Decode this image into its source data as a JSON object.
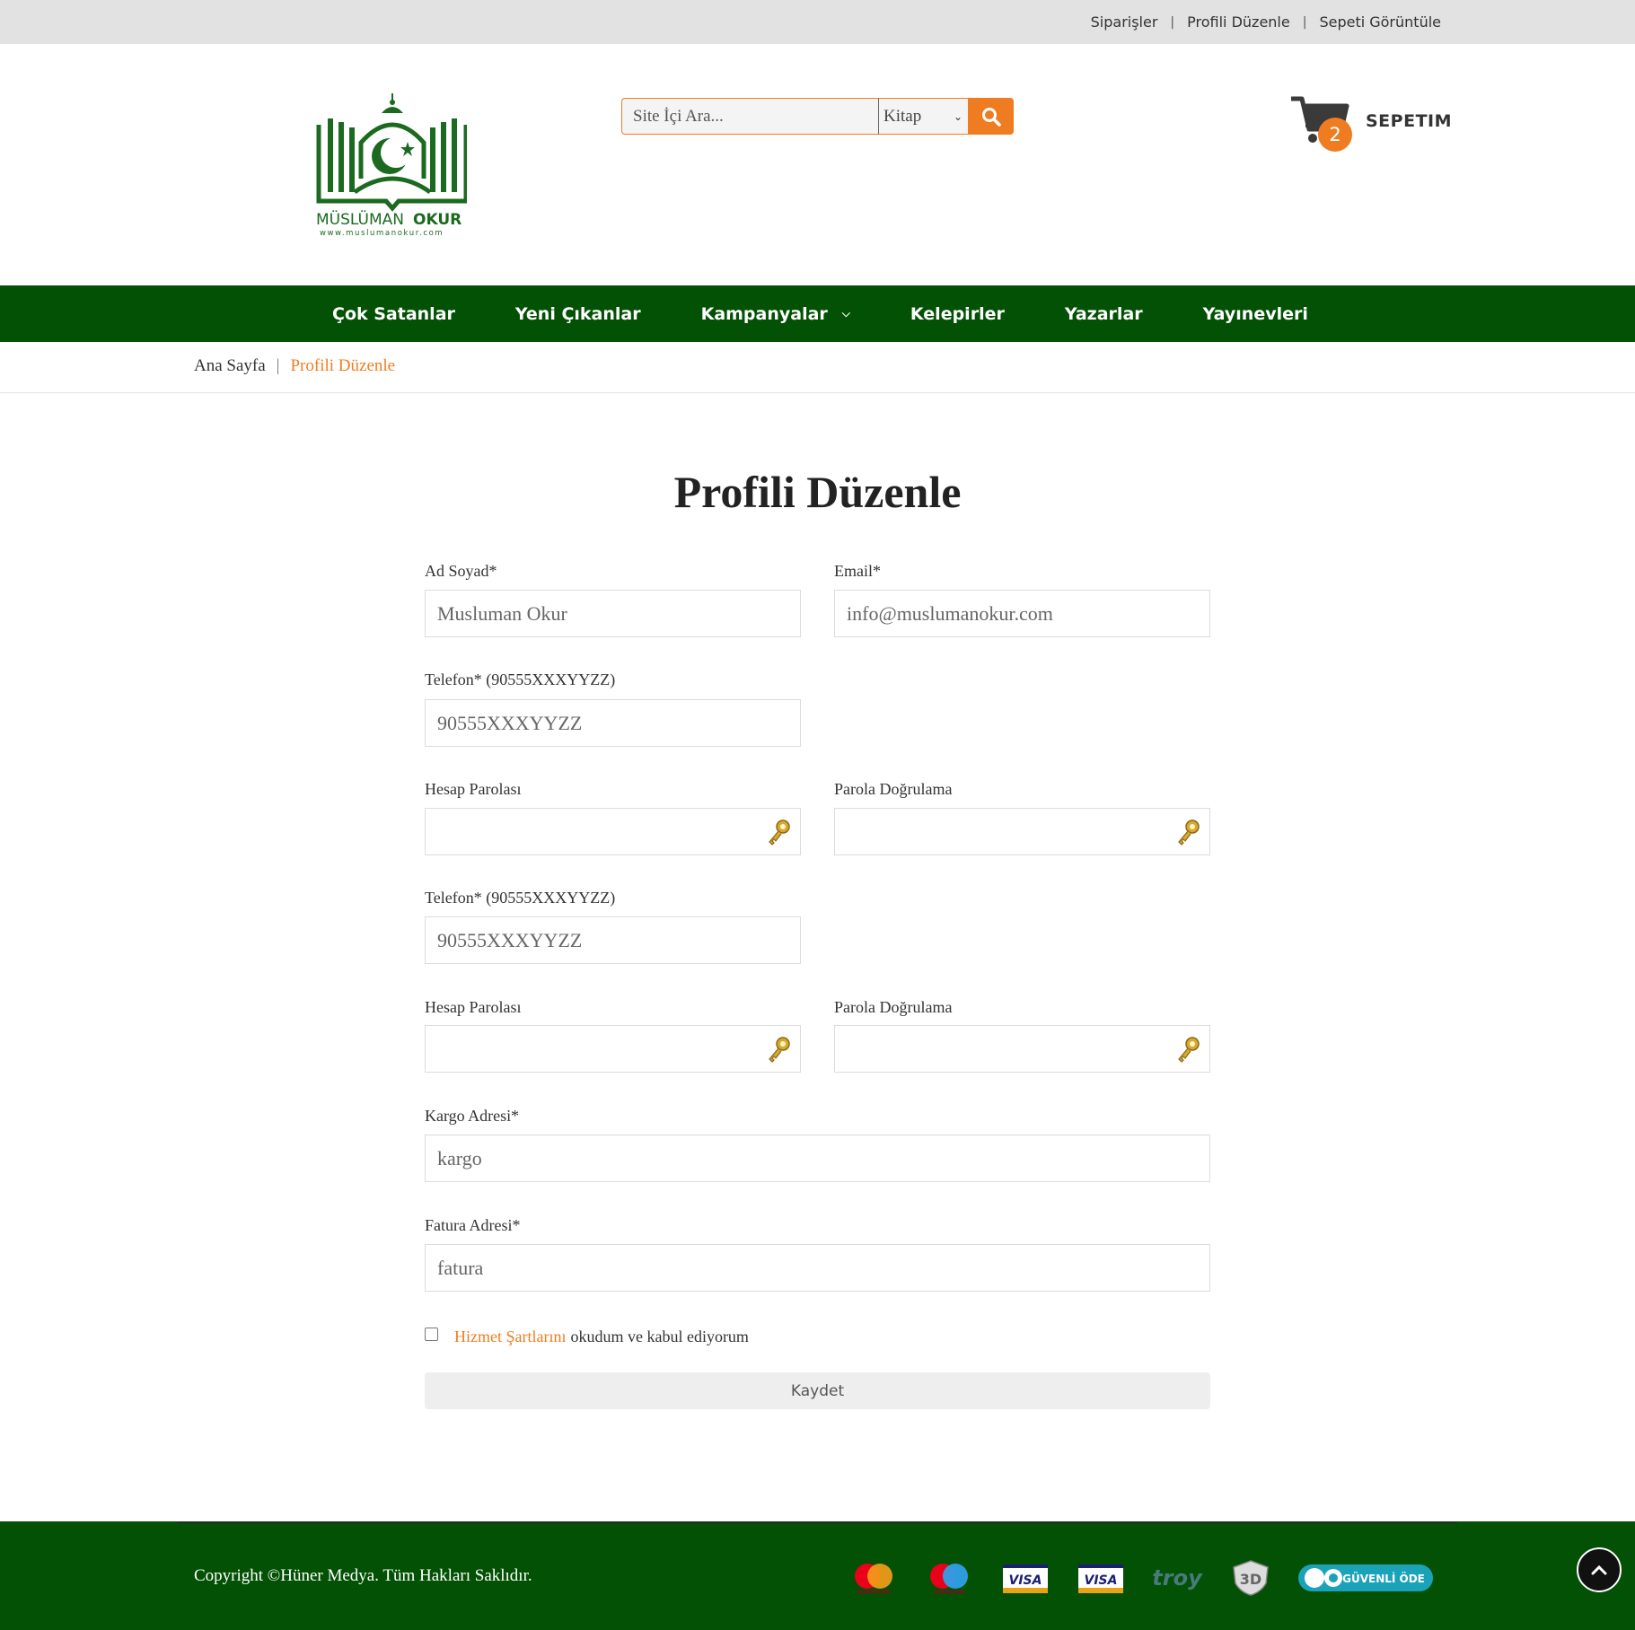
{
  "top_links": [
    "Siparişler",
    "Profili Düzenle",
    "Sepeti Görüntüle"
  ],
  "top_sep": "|",
  "logo": {
    "name_left": "MÜSLÜMAN",
    "name_right": "OKUR",
    "url": "www.muslumanokur.com"
  },
  "search": {
    "placeholder": "Site İçi Ara...",
    "category": "Kitap",
    "icon": "search-icon"
  },
  "cart": {
    "count": "2",
    "label": "SEPETIM",
    "icon": "cart-icon"
  },
  "nav": [
    "Çok Satanlar",
    "Yeni Çıkanlar",
    "Kampanyalar",
    "Kelepirler",
    "Yazarlar",
    "Yayınevleri"
  ],
  "breadcrumb": {
    "home": "Ana Sayfa",
    "sep": "|",
    "current": "Profili Düzenle"
  },
  "form": {
    "title": "Profili Düzenle",
    "name_label": "Ad Soyad*",
    "name_value": "Musluman Okur",
    "email_label": "Email*",
    "email_value": "info@muslumanokur.com",
    "phone_label": "Telefon* (90555XXXYYZZ)",
    "phone_value": "90555XXXYYZZ",
    "password_label": "Hesap Parolası",
    "password_confirm_label": "Parola Doğrulama",
    "phone2_label": "Telefon* (90555XXXYYZZ)",
    "phone2_value": "90555XXXYYZZ",
    "password2_label": "Hesap Parolası",
    "password2_confirm_label": "Parola Doğrulama",
    "shipping_label": "Kargo Adresi*",
    "shipping_value": "kargo",
    "billing_label": "Fatura Adresi*",
    "billing_value": "fatura",
    "terms_link": "Hizmet Şartlarını",
    "terms_text": "okudum ve kabul ediyorum",
    "save_label": "Kaydet"
  },
  "footer": {
    "copyright": "Copyright ©Hüner Medya. Tüm Hakları Saklıdır.",
    "payment_logos": [
      "mastercard",
      "maestro",
      "VISA",
      "VISA",
      "troy",
      "3D SECURE",
      "GO GÜVENLİ ÖDE"
    ],
    "go_label": "GÜVENLİ ÖDE",
    "secure_label": "3D"
  },
  "colors": {
    "accent": "#f07c22",
    "brand_green": "#035104",
    "topbar": "#e2e2e2"
  }
}
